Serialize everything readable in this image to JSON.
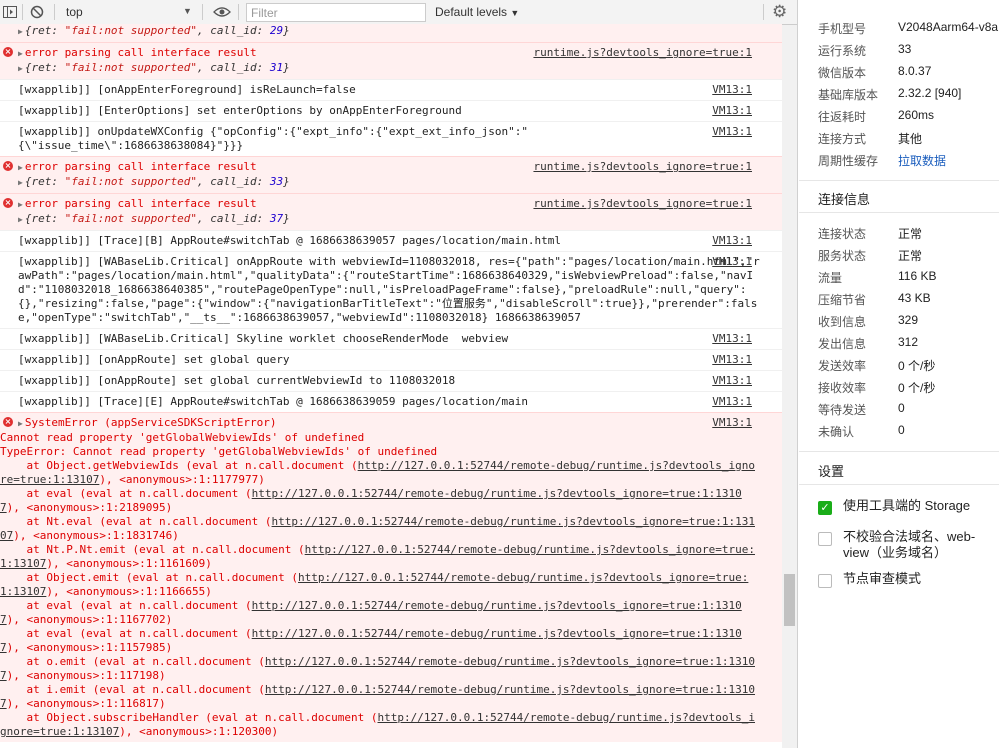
{
  "toolbar": {
    "context": "top",
    "filter_placeholder": "Filter",
    "levels": "Default levels"
  },
  "console": {
    "ret_prefix": "{ret: ",
    "ret_value": "\"fail:not supported\"",
    "callid_key": "call_id: ",
    "callid_29": "29",
    "callid_31": "31",
    "callid_33": "33",
    "callid_37": "37",
    "err_parse": "error parsing call interface result",
    "src_runtime": "runtime.js?devtools_ignore=true:1",
    "src_vm": "VM13:1",
    "msg_relaunch": "[wxapplib]] [onAppEnterForeground] isReLaunch=false",
    "msg_enteroptions": "[wxapplib]] [EnterOptions] set enterOptions by onAppEnterForeground",
    "msg_wxconfig": "[wxapplib]] onUpdateWXConfig {\"opConfig\":{\"expt_info\":{\"expt_ext_info_json\":\"{\\\"issue_time\\\":1686638638084}\"}}}",
    "msg_trace_b": "[wxapplib]] [Trace][B] AppRoute#switchTab @ 1686638639057 pages/location/main.html",
    "msg_approute": "[wxapplib]] [WABaseLib.Critical] onAppRoute with webviewId=1108032018, res={\"path\":\"pages/location/main.html\",\"rawPath\":\"pages/location/main.html\",\"qualityData\":{\"routeStartTime\":1686638640329,\"isWebviewPreload\":false,\"navId\":\"1108032018_1686638640385\",\"routePageOpenType\":null,\"isPreloadPageFrame\":false},\"preloadRule\":null,\"query\":{},\"resizing\":false,\"page\":{\"window\":{\"navigationBarTitleText\":\"位置服务\",\"disableScroll\":true}},\"prerender\":false,\"openType\":\"switchTab\",\"__ts__\":1686638639057,\"webviewId\":1108032018} 1686638639057",
    "msg_skyline": "[wxapplib]] [WABaseLib.Critical] Skyline worklet chooseRenderMode  webview",
    "msg_setquery": "[wxapplib]] [onAppRoute] set global query",
    "msg_setwebview": "[wxapplib]] [onAppRoute] set global currentWebviewId to 1108032018",
    "msg_trace_e": "[wxapplib]] [Trace][E] AppRoute#switchTab @ 1686638639059 pages/location/main",
    "sys_title": "SystemError (appServiceSDKScriptError)",
    "sys_line1": "Cannot read property 'getGlobalWebviewIds' of undefined",
    "sys_line2": "TypeError: Cannot read property 'getGlobalWebviewIds' of undefined",
    "stack": [
      {
        "pre": "    at Object.getWebviewIds (eval at n.call.document (",
        "url": "http://127.0.0.1:52744/remote-debug/runtime.js?devtools_ignore=true:1:13107",
        "post": "), <anonymous>:1:1177977)"
      },
      {
        "pre": "    at eval (eval at n.call.document (",
        "url": "http://127.0.0.1:52744/remote-debug/runtime.js?devtools_ignore=true:1:13107",
        "post": "), <anonymous>:1:2189095)"
      },
      {
        "pre": "    at Nt.eval (eval at n.call.document (",
        "url": "http://127.0.0.1:52744/remote-debug/runtime.js?devtools_ignore=true:1:13107",
        "post": "), <anonymous>:1:1831746)"
      },
      {
        "pre": "    at Nt.P.Nt.emit (eval at n.call.document (",
        "url": "http://127.0.0.1:52744/remote-debug/runtime.js?devtools_ignore=true:1:13107",
        "post": "), <anonymous>:1:1161609)"
      },
      {
        "pre": "    at Object.emit (eval at n.call.document (",
        "url": "http://127.0.0.1:52744/remote-debug/runtime.js?devtools_ignore=true:1:13107",
        "post": "), <anonymous>:1:1166655)"
      },
      {
        "pre": "    at eval (eval at n.call.document (",
        "url": "http://127.0.0.1:52744/remote-debug/runtime.js?devtools_ignore=true:1:13107",
        "post": "), <anonymous>:1:1167702)"
      },
      {
        "pre": "    at eval (eval at n.call.document (",
        "url": "http://127.0.0.1:52744/remote-debug/runtime.js?devtools_ignore=true:1:13107",
        "post": "), <anonymous>:1:1157985)"
      },
      {
        "pre": "    at o.emit (eval at n.call.document (",
        "url": "http://127.0.0.1:52744/remote-debug/runtime.js?devtools_ignore=true:1:13107",
        "post": "), <anonymous>:1:117198)"
      },
      {
        "pre": "    at i.emit (eval at n.call.document (",
        "url": "http://127.0.0.1:52744/remote-debug/runtime.js?devtools_ignore=true:1:13107",
        "post": "), <anonymous>:1:116817)"
      },
      {
        "pre": "    at Object.subscribeHandler (eval at n.call.document (",
        "url": "http://127.0.0.1:52744/remote-debug/runtime.js?devtools_ignore=true:1:13107",
        "post": "), <anonymous>:1:120300)"
      }
    ]
  },
  "side": {
    "device": [
      {
        "key": "手机型号",
        "value": "V2048Aarm64-v8a"
      },
      {
        "key": "运行系统",
        "value": "33"
      },
      {
        "key": "微信版本",
        "value": "8.0.37"
      },
      {
        "key": "基础库版本",
        "value": "2.32.2 [940]"
      },
      {
        "key": "往返耗时",
        "value": "260ms"
      },
      {
        "key": "连接方式",
        "value": "其他"
      },
      {
        "key": "周期性缓存",
        "value": "拉取数据"
      }
    ],
    "conn_title": "连接信息",
    "conn": [
      {
        "key": "连接状态",
        "value": "正常"
      },
      {
        "key": "服务状态",
        "value": "正常"
      },
      {
        "key": "流量",
        "value": "116 KB"
      },
      {
        "key": "压缩节省",
        "value": "43 KB"
      },
      {
        "key": "收到信息",
        "value": "329"
      },
      {
        "key": "发出信息",
        "value": "312"
      },
      {
        "key": "发送效率",
        "value": "0 个/秒"
      },
      {
        "key": "接收效率",
        "value": "0 个/秒"
      },
      {
        "key": "等待发送",
        "value": "0"
      },
      {
        "key": "未确认",
        "value": "0"
      }
    ],
    "settings_title": "设置",
    "settings": [
      {
        "label": "使用工具端的 Storage",
        "checked": true
      },
      {
        "label": "不校验合法域名、web-view（业务域名）",
        "checked": false
      },
      {
        "label": "节点审查模式",
        "checked": false
      }
    ],
    "status_color": "#28b14c",
    "link_color": "#1a5dbd"
  }
}
